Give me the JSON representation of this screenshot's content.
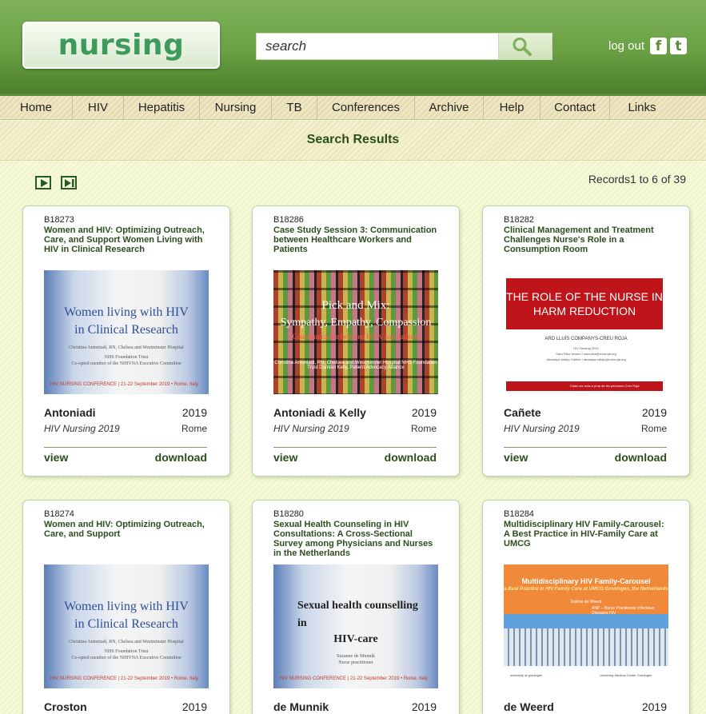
{
  "header": {
    "logo": "nursing",
    "search_placeholder": "search",
    "logout_label": "log out",
    "social_facebook": "f",
    "social_twitter": "t"
  },
  "nav": [
    "Home",
    "HIV",
    "Hepatitis",
    "Nursing",
    "TB",
    "Conferences",
    "Archive",
    "Help",
    "Contact",
    "Links"
  ],
  "results": {
    "title": "Search Results",
    "records": "Records1 to 6 of 39"
  },
  "cards": [
    {
      "id": "B18273",
      "title": "Women and HIV: Optimizing Outreach, Care, and Support Women Living with HIV in Clinical Research",
      "author": "Antoniadi",
      "year": "2019",
      "conference": "HIV Nursing 2019",
      "location": "Rome",
      "view": "view",
      "download": "download",
      "thumb": {
        "line1": "Women living with HIV",
        "line2": "in Clinical Research",
        "line3": "Christina Antoniadi, RN, Chelsea and Westminster Hospital",
        "line4": "NHS Foundation Trust",
        "line5": "Co-opted member of the NHIVNA Executive Committee",
        "footer": "HIV NURSING CONFERENCE | 21-22 September 2019 • Rome, Italy"
      }
    },
    {
      "id": "B18286",
      "title": "Case Study Session 3: Communication between Healthcare Workers and Patients",
      "author": "Antoniadi & Kelly",
      "year": "2019",
      "conference": "HIV Nursing 2019",
      "location": "Rome",
      "view": "view",
      "download": "download",
      "thumb": {
        "line1": "Pick and Mix:",
        "line2": "Sympathy, Empathy, Compassion",
        "line3": "Communication between HCW and patients",
        "line4": "Christina Antoniadi, RN, Chelsea and Westminster Hospital NHS Foundation Trust Damian Kelly, Patient Advocacy Alliance"
      }
    },
    {
      "id": "B18282",
      "title": "Clinical Management and Treatment Challenges Nurse's Role in a Consumption Room",
      "author": "Cañete",
      "year": "2019",
      "conference": "HIV Nursing 2019",
      "location": "Rome",
      "view": "view",
      "download": "download",
      "thumb": {
        "line1": "THE ROLE OF THE NURSE IN",
        "line2": "HARM REDUCTION",
        "line3": "ARD LLUÍS COMPANYS-CREU ROJA",
        "line4": "HIV Nursing 2019",
        "line5": "Sara Rika Venero / sara.rika@creuroja.org",
        "line6": "•Ainalaya Vallejo Cañete / ainalaya.vallejo@creuroja.org",
        "footer": "Cada vez más a prop de les persones  Creu Roja"
      }
    },
    {
      "id": "B18274",
      "title": "Women and HIV: Optimizing Outreach, Care, and Support",
      "author": "Croston",
      "year": "2019",
      "conference": "",
      "location": "",
      "view": "",
      "download": "",
      "thumb": {
        "line1": "Women living with HIV",
        "line2": "in Clinical Research",
        "line3": "Christina Antoniadi, RN, Chelsea and Westminster Hospital",
        "line4": "NHS Foundation Trust",
        "line5": "Co-opted member of the NHIVNA Executive Committee",
        "footer": "HIV NURSING CONFERENCE | 21-22 September 2019 • Rome, Italy"
      }
    },
    {
      "id": "B18280",
      "title": "Sexual Health Counseling in HIV Consultations: A Cross-Sectional Survey among Physicians and Nurses in the Netherlands",
      "author": "de Munnik",
      "year": "2019",
      "conference": "",
      "location": "",
      "view": "",
      "download": "",
      "thumb": {
        "line1": "Sexual health counselling",
        "line2": "in",
        "line3": "HIV-care",
        "line4": "Suzanne de Munnik",
        "line5": "Nurse practitioner",
        "footer": "HIV NURSING CONFERENCE | 21-22 September 2019 • Rome, Italy"
      }
    },
    {
      "id": "B18284",
      "title": "Multidisciplinary HIV Family-Carousel: A Best Practice in HIV-Family Care at UMCG",
      "author": "de Weerd",
      "year": "2019",
      "conference": "",
      "location": "",
      "view": "",
      "download": "",
      "thumb": {
        "line1": "Multidisciplinary HIV Family-Carousel",
        "line2": "a Best Practice in HIV-Family Care at UMCG Groningen, the Netherlands",
        "line3": "Doléne de Weerd",
        "line4": "ANP – Nurse Practitioner Infectious Diseases HIV",
        "logo1": "university of groningen",
        "logo2": "University Medical Center Groningen"
      }
    }
  ]
}
